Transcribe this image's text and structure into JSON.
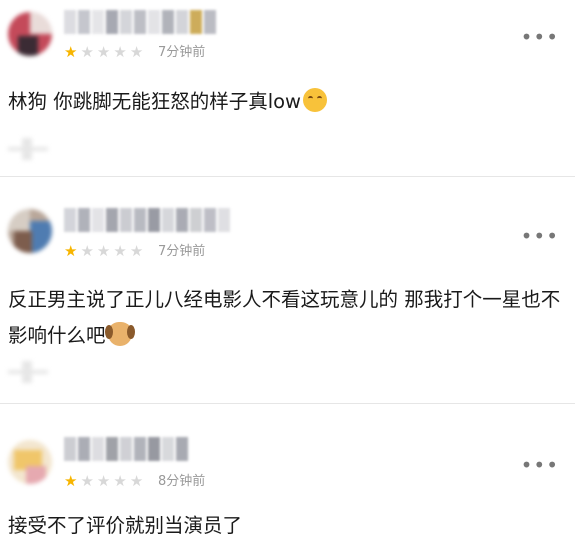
{
  "comments": [
    {
      "rating": 1,
      "time": "7分钟前",
      "text": "林狗 你跳脚无能狂怒的样子真low",
      "emoji": "hugging-face-emoji"
    },
    {
      "rating": 1,
      "time": "7分钟前",
      "text": "反正男主说了正儿八经电影人不看这玩意儿的 那我打个一星也不影响什么吧",
      "emoji": "dog-face-emoji"
    },
    {
      "rating": 1,
      "time": "8分钟前",
      "text": "接受不了评价就别当演员了",
      "emoji": ""
    }
  ],
  "more_label": "•••",
  "star_glyph": "★",
  "colors": {
    "star_on": "#f7b500",
    "star_off": "#d8d8d8",
    "time": "#9a9a9a"
  }
}
